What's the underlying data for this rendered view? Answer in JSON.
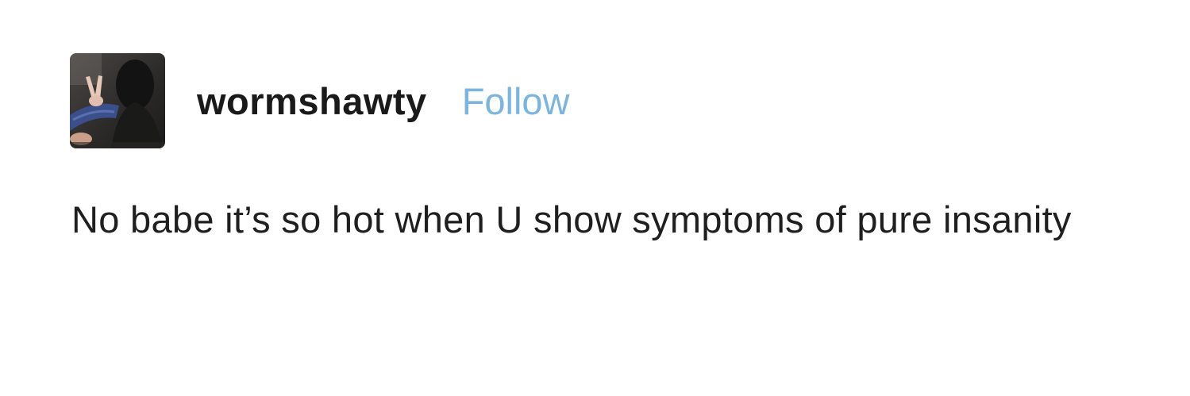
{
  "post": {
    "author": {
      "username": "wormshawty",
      "follow_label": "Follow",
      "avatar_icon": "avatar-photo"
    },
    "body_text": "No babe it’s so hot when U show symptoms of pure insanity"
  },
  "colors": {
    "follow_link": "#7ab4e0",
    "text": "#1f1f1f",
    "background": "#ffffff"
  }
}
